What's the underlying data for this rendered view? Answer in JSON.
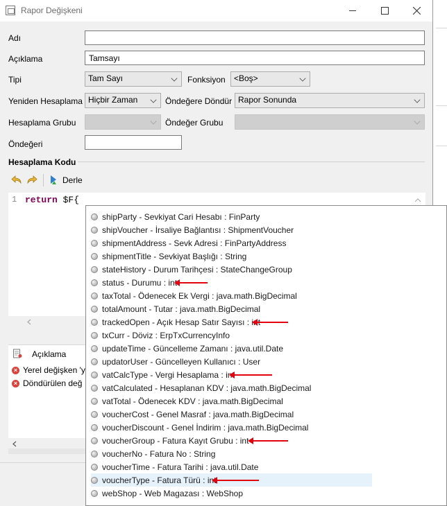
{
  "window": {
    "title": "Rapor Değişkeni"
  },
  "form": {
    "name_label": "Adı",
    "name_value": "",
    "desc_label": "Açıklama",
    "desc_value": "Tamsayı",
    "type_label": "Tipi",
    "type_value": "Tam Sayı",
    "function_label": "Fonksiyon",
    "function_value": "<Boş>",
    "recalc_label": "Yeniden Hesaplama",
    "recalc_value": "Hiçbir Zaman",
    "reset_label": "Öndeğere Döndür",
    "reset_value": "Rapor Sonunda",
    "calc_group_label": "Hesaplama Grubu",
    "calc_group_value": "",
    "default_group_label": "Öndeğer Grubu",
    "default_group_value": "",
    "default_label": "Öndeğeri",
    "default_value": ""
  },
  "code_section": {
    "title": "Hesaplama Kodu",
    "compile_label": "Derle",
    "line_number": "1",
    "code_keyword": "return",
    "code_rest": " $F{"
  },
  "problems": {
    "header": "Açıklama",
    "rows": [
      "Yerel değişken 'y",
      "Döndürülen değ"
    ]
  },
  "autocomplete": {
    "items": [
      "shipParty - Sevkiyat Cari Hesabı : FinParty",
      "shipVoucher - İrsaliye Bağlantısı : ShipmentVoucher",
      "shipmentAddress - Sevk Adresi : FinPartyAddress",
      "shipmentTitle - Sevkiyat Başlığı : String",
      "stateHistory - Durum Tarihçesi : StateChangeGroup",
      "status - Durumu : int",
      "taxTotal - Ödenecek Ek Vergi : java.math.BigDecimal",
      "totalAmount - Tutar : java.math.BigDecimal",
      "trackedOpen - Açık Hesap Satır Sayısı : int",
      "txCurr - Döviz : ErpTxCurrencyInfo",
      "updateTime - Güncelleme Zamanı : java.util.Date",
      "updatorUser - Güncelleyen Kullanıcı : User",
      "vatCalcType - Vergi Hesaplama : int",
      "vatCalculated - Hesaplanan KDV : java.math.BigDecimal",
      "vatTotal - Ödenecek KDV : java.math.BigDecimal",
      "voucherCost - Genel Masraf : java.math.BigDecimal",
      "voucherDiscount - Genel İndirim : java.math.BigDecimal",
      "voucherGroup - Fatura Kayıt Grubu : int",
      "voucherNo - Fatura No : String",
      "voucherTime - Fatura Tarihi : java.util.Date",
      "voucherType - Fatura Türü : int",
      "webShop - Web Magazası : WebShop"
    ],
    "selected_index": 20,
    "highlighted_indices": [
      5,
      8,
      12,
      17,
      20
    ]
  },
  "colors": {
    "arrow": "#e3000f",
    "selection": "#e5f1fb",
    "keyword": "#7f0055"
  }
}
